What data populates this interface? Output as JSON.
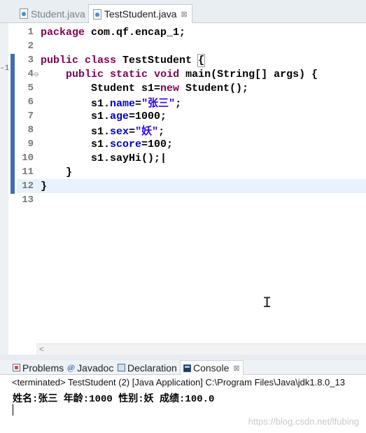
{
  "tabs": [
    {
      "label": "Student.java",
      "active": false
    },
    {
      "label": "TestStudent.java",
      "active": true,
      "close": "⊠"
    }
  ],
  "editor": {
    "left_edge_marker": "-1",
    "lines": [
      {
        "n": "1",
        "code": "package com.qf.encap_1;"
      },
      {
        "n": "2",
        "code": ""
      },
      {
        "n": "3",
        "code": "public class TestStudent {"
      },
      {
        "n": "4",
        "code": "    public static void main(String[] args) {",
        "fold": "⊖"
      },
      {
        "n": "5",
        "code": "        Student s1=new Student();"
      },
      {
        "n": "6",
        "code": "        s1.name=\"张三\";"
      },
      {
        "n": "7",
        "code": "        s1.age=1000;"
      },
      {
        "n": "8",
        "code": "        s1.sex=\"妖\";"
      },
      {
        "n": "9",
        "code": "        s1.score=100;"
      },
      {
        "n": "10",
        "code": "        s1.sayHi();"
      },
      {
        "n": "11",
        "code": "    }"
      },
      {
        "n": "12",
        "code": "}"
      },
      {
        "n": "13",
        "code": ""
      }
    ],
    "highlighted_line": 12,
    "ibeam": "I",
    "scroll_left_arrow": "<"
  },
  "views": {
    "tabs": [
      {
        "label": "Problems",
        "icon": "problems-icon"
      },
      {
        "label": "Javadoc",
        "icon": "javadoc-icon",
        "glyph": "@"
      },
      {
        "label": "Declaration",
        "icon": "declaration-icon"
      },
      {
        "label": "Console",
        "icon": "console-icon",
        "active": true,
        "close": "⊠"
      }
    ]
  },
  "console": {
    "header": "<terminated> TestStudent (2) [Java Application] C:\\Program Files\\Java\\jdk1.8.0_13",
    "output": "姓名:张三 年龄:1000 性别:妖 成绩:100.0"
  },
  "watermark": "https://blog.csdn.net/lfubing",
  "colors": {
    "keyword": "#7f0055",
    "field": "#0000c0",
    "string": "#2a00ff",
    "line_highlight": "#e8f2fe",
    "ruler": "#3e6fae"
  }
}
